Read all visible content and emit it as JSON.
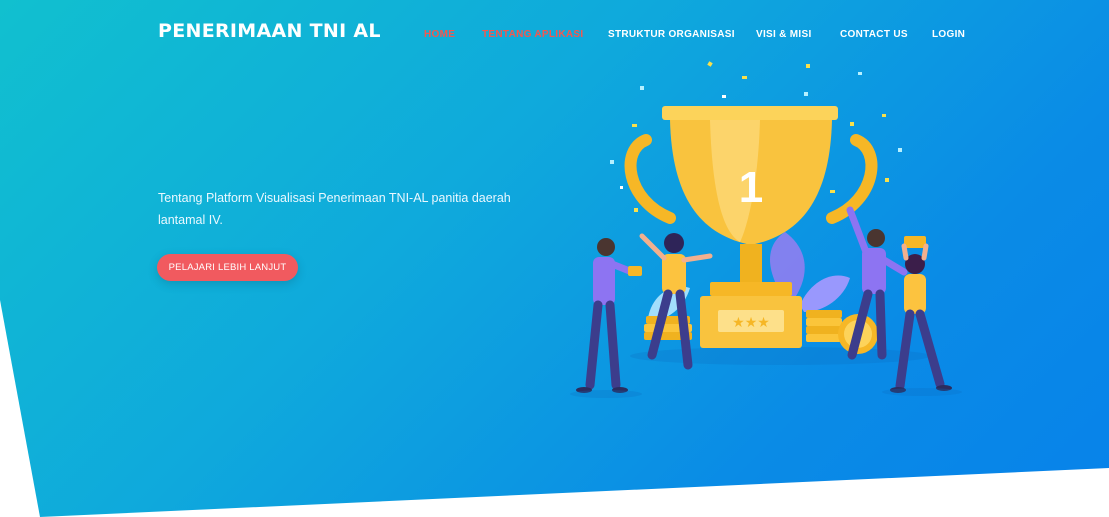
{
  "brand": {
    "title": "PENERIMAAN TNI AL"
  },
  "nav": {
    "items": [
      {
        "label": "HOME",
        "active": true
      },
      {
        "label": "TENTANG APLIKASI",
        "active": true
      },
      {
        "label": "STRUKTUR ORGANISASI",
        "active": false
      },
      {
        "label": "VISI & MISI",
        "active": false
      },
      {
        "label": "CONTACT US",
        "active": false
      },
      {
        "label": "LOGIN",
        "active": false
      }
    ]
  },
  "hero": {
    "description": "Tentang Platform Visualisasi Penerimaan TNI-AL panitia daerah lantamal IV.",
    "cta_label": "PELAJARI LEBIH LANJUT"
  },
  "illustration": {
    "trophy_number": "1",
    "icon": "trophy-celebration-illustration"
  },
  "colors": {
    "gradient_start": "#11c0cf",
    "gradient_end": "#0782ea",
    "accent": "#f15a5f",
    "active_nav": "#f4574f",
    "trophy_gold": "#f9c33e"
  }
}
